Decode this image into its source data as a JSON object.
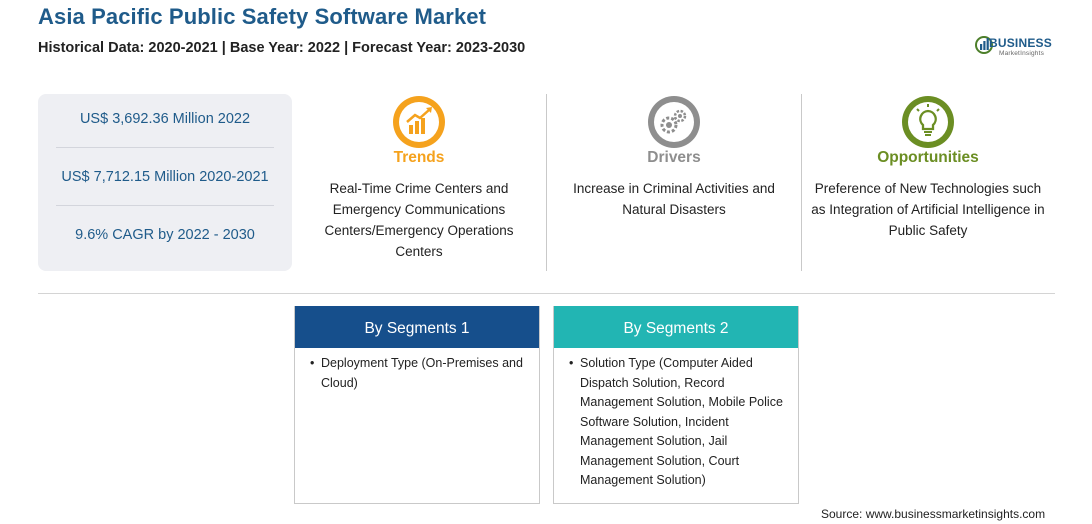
{
  "header": {
    "title": "Asia Pacific Public Safety Software Market",
    "subtitle": "Historical Data: 2020-2021 | Base Year: 2022 | Forecast Year: 2023-2030"
  },
  "logo": {
    "brand": "BUSINESS",
    "sub": "MarketInsights"
  },
  "stats": [
    "US$ 3,692.36 Million 2022",
    "US$ 7,712.15 Million 2020-2021",
    "9.6% CAGR by 2022 - 2030"
  ],
  "columns": {
    "trends": {
      "title": "Trends",
      "icon": "growth-chart-icon",
      "color": "#f5a21d",
      "text": "Real-Time Crime Centers and Emergency Communications Centers/Emergency Operations Centers"
    },
    "drivers": {
      "title": "Drivers",
      "icon": "gears-icon",
      "color": "#8e8e8e",
      "text": "Increase in Criminal Activities and Natural Disasters"
    },
    "opportunities": {
      "title": "Opportunities",
      "icon": "lightbulb-icon",
      "color": "#6b8e23",
      "text": "Preference of New Technologies such as Integration of Artificial Intelligence in Public Safety"
    }
  },
  "segments": [
    {
      "title": "By Segments 1",
      "color": "#164f8c",
      "items": [
        "Deployment Type (On-Premises and Cloud)"
      ]
    },
    {
      "title": "By Segments 2",
      "color": "#22b5b3",
      "items": [
        "Solution Type (Computer Aided Dispatch Solution, Record Management Solution, Mobile Police Software Solution, Incident Management Solution, Jail Management Solution, Court Management Solution)"
      ]
    }
  ],
  "source": "Source: www.businessmarketinsights.com"
}
